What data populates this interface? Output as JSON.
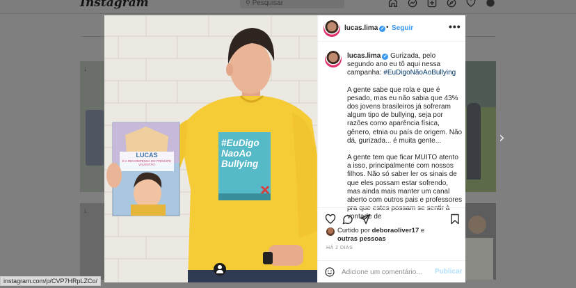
{
  "app": {
    "logo": "Instagram",
    "search_placeholder": "Pesquisar"
  },
  "nav_icons": [
    "home-icon",
    "messenger-icon",
    "new-post-icon",
    "explore-icon",
    "activity-heart-icon",
    "profile-avatar-icon"
  ],
  "post": {
    "username": "lucas.lima",
    "follow_label": "Seguir",
    "dot": "•",
    "more_label": "•••",
    "caption_intro": "Gurizada, pelo segundo ano eu tô aqui nessa campanha:",
    "hashtag": "#EuDigoNãoAoBullying",
    "paragraph_1": "A gente sabe que rola e que é pesado, mas eu não sabia que 43% dos jovens brasileiros já sofreram algum tipo de bullying, seja por razões como aparência física, gênero, etnia ou país de origem. Não dá, gurizada... é muita gente...",
    "paragraph_2": "A gente tem que ficar MUITO atento a isso, principalmente com nossos filhos. Não só saber ler os sinais de que eles possam estar sofrendo, mas ainda mais manter um canal aberto com outros pais e professores pra que estes possam se sentir à vontade de",
    "liked_prefix": "Curtido por",
    "liked_user": "deboraoliver17",
    "liked_joiner": "e",
    "liked_others": "outras pessoas",
    "time_ago": "HÁ 2 DIAS",
    "comment_placeholder": "Adicione um comentário...",
    "publish_label": "Publicar"
  },
  "photo": {
    "shirt_text": [
      "#EuDigo",
      "NaoAo",
      "Bullying"
    ],
    "book_title": "LUCAS",
    "book_subtitle": "E A RECOMPENSA DO PRÍNCIPE VALENTÃO"
  },
  "status_bar": {
    "url": "instagram.com/p/CVP7HRpLZCo/"
  },
  "colors": {
    "accent_blue": "#3897f0",
    "shirt_yellow": "#f5cb36",
    "hashtag_box": "#55b9c7",
    "overlay": "#7f7f7f"
  }
}
